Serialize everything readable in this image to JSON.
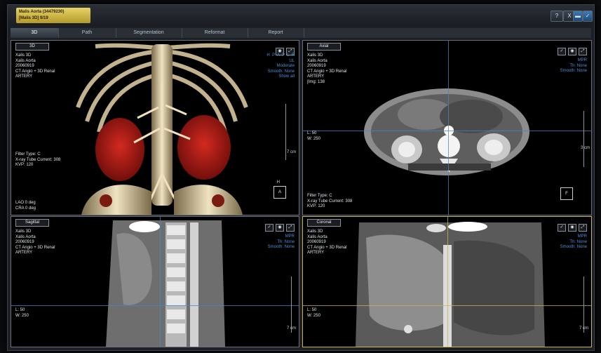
{
  "patient": {
    "line1": "Malis Aorta (34479230)",
    "line2": "[Malis 3D] 9/19"
  },
  "window_buttons": {
    "help": "?",
    "close": "X"
  },
  "tabs": [
    "3D",
    "Path",
    "Segmentation",
    "Reformat",
    "Report"
  ],
  "viewports": {
    "v3d": {
      "label": "3D",
      "info": "Xalis 3D\nXalis Aorta\n20060919\nCT Angio + 3D Renal\nARTERY",
      "right": "H  P  A  P  L  R\nUL\nModerate\nSmooth: None\nShow all",
      "filter": "Filter Type: C\nX-ray Tube Current: 308\nKVP: 120",
      "angles": "LAO 0 deg\nCRA 0 deg",
      "scale": "7 cm",
      "orient_top": "H",
      "orient": "A"
    },
    "axial": {
      "label": "Axial",
      "info": "Xalis 3D\nXalis Aorta\n20060919\nCT Angio + 3D Renal\nARTERY\n[Img: 138",
      "right": "MPR\nTh: None\nSmooth: None",
      "wl": "L: 50\nW: 250",
      "filter": "Filter Type: C\nX-ray Tube Current: 308\nKVP: 120",
      "scale": "3 cm",
      "orient": "F"
    },
    "sagittal": {
      "label": "Sagittal",
      "info": "Xalis 3D\nXalis Aorta\n20060919\nCT Angio + 3D Renal\nARTERY",
      "right": "MPR\nTh: None\nSmooth: None",
      "wl": "L: 50\nW: 250",
      "scale": "7 cm"
    },
    "coronal": {
      "label": "Coronal",
      "info": "Xalis 3D\nXalis Aorta\n20060919\nCT Angio + 3D Renal\nARTERY",
      "right": "MPR\nTh: None\nSmooth: None",
      "wl": "L: 50\nW: 250",
      "scale": "7 cm"
    }
  },
  "colors": {
    "crosshair": "#4a86c8",
    "kidney": "#b01818",
    "bone": "#e6d6b0",
    "patient_tab": "#d9c14e"
  }
}
